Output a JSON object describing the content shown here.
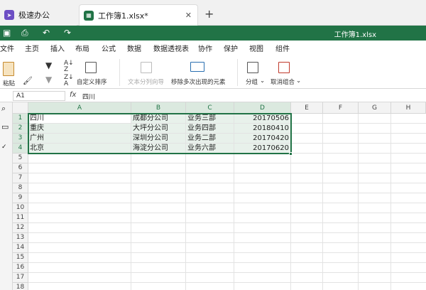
{
  "tabs": {
    "home_label": "极速办公",
    "file_label": "工作簿1.xlsx*"
  },
  "title": "工作簿1.xlsx",
  "menu": [
    "文件",
    "主页",
    "插入",
    "布局",
    "公式",
    "数据",
    "数据透视表",
    "协作",
    "保护",
    "视图",
    "组件"
  ],
  "ribbon": {
    "paste": "粘贴",
    "custom_sort": "自定义排序",
    "text_to_columns": "文本分列向导",
    "remove_duplicates": "移除多次出现的元素",
    "group": "分组",
    "ungroup": "取消组合"
  },
  "formula": {
    "name_box": "A1",
    "fx": "fx",
    "value": "四川"
  },
  "columns": [
    "A",
    "B",
    "C",
    "D",
    "E",
    "F",
    "G",
    "H"
  ],
  "rows": [
    "1",
    "2",
    "3",
    "4",
    "5",
    "6",
    "7",
    "8",
    "9",
    "10",
    "11",
    "12",
    "13",
    "14",
    "15",
    "16",
    "17",
    "18"
  ],
  "cells": [
    [
      "四川",
      "成都分公司",
      "业务三部",
      "20170506"
    ],
    [
      "重庆",
      "大坪分公司",
      "业务四部",
      "20180410"
    ],
    [
      "广州",
      "深圳分公司",
      "业务二部",
      "20170420"
    ],
    [
      "北京",
      "海淀分公司",
      "业务六部",
      "20170620"
    ]
  ],
  "colors": {
    "accent": "#217346",
    "selection": "#e8f1eb"
  }
}
